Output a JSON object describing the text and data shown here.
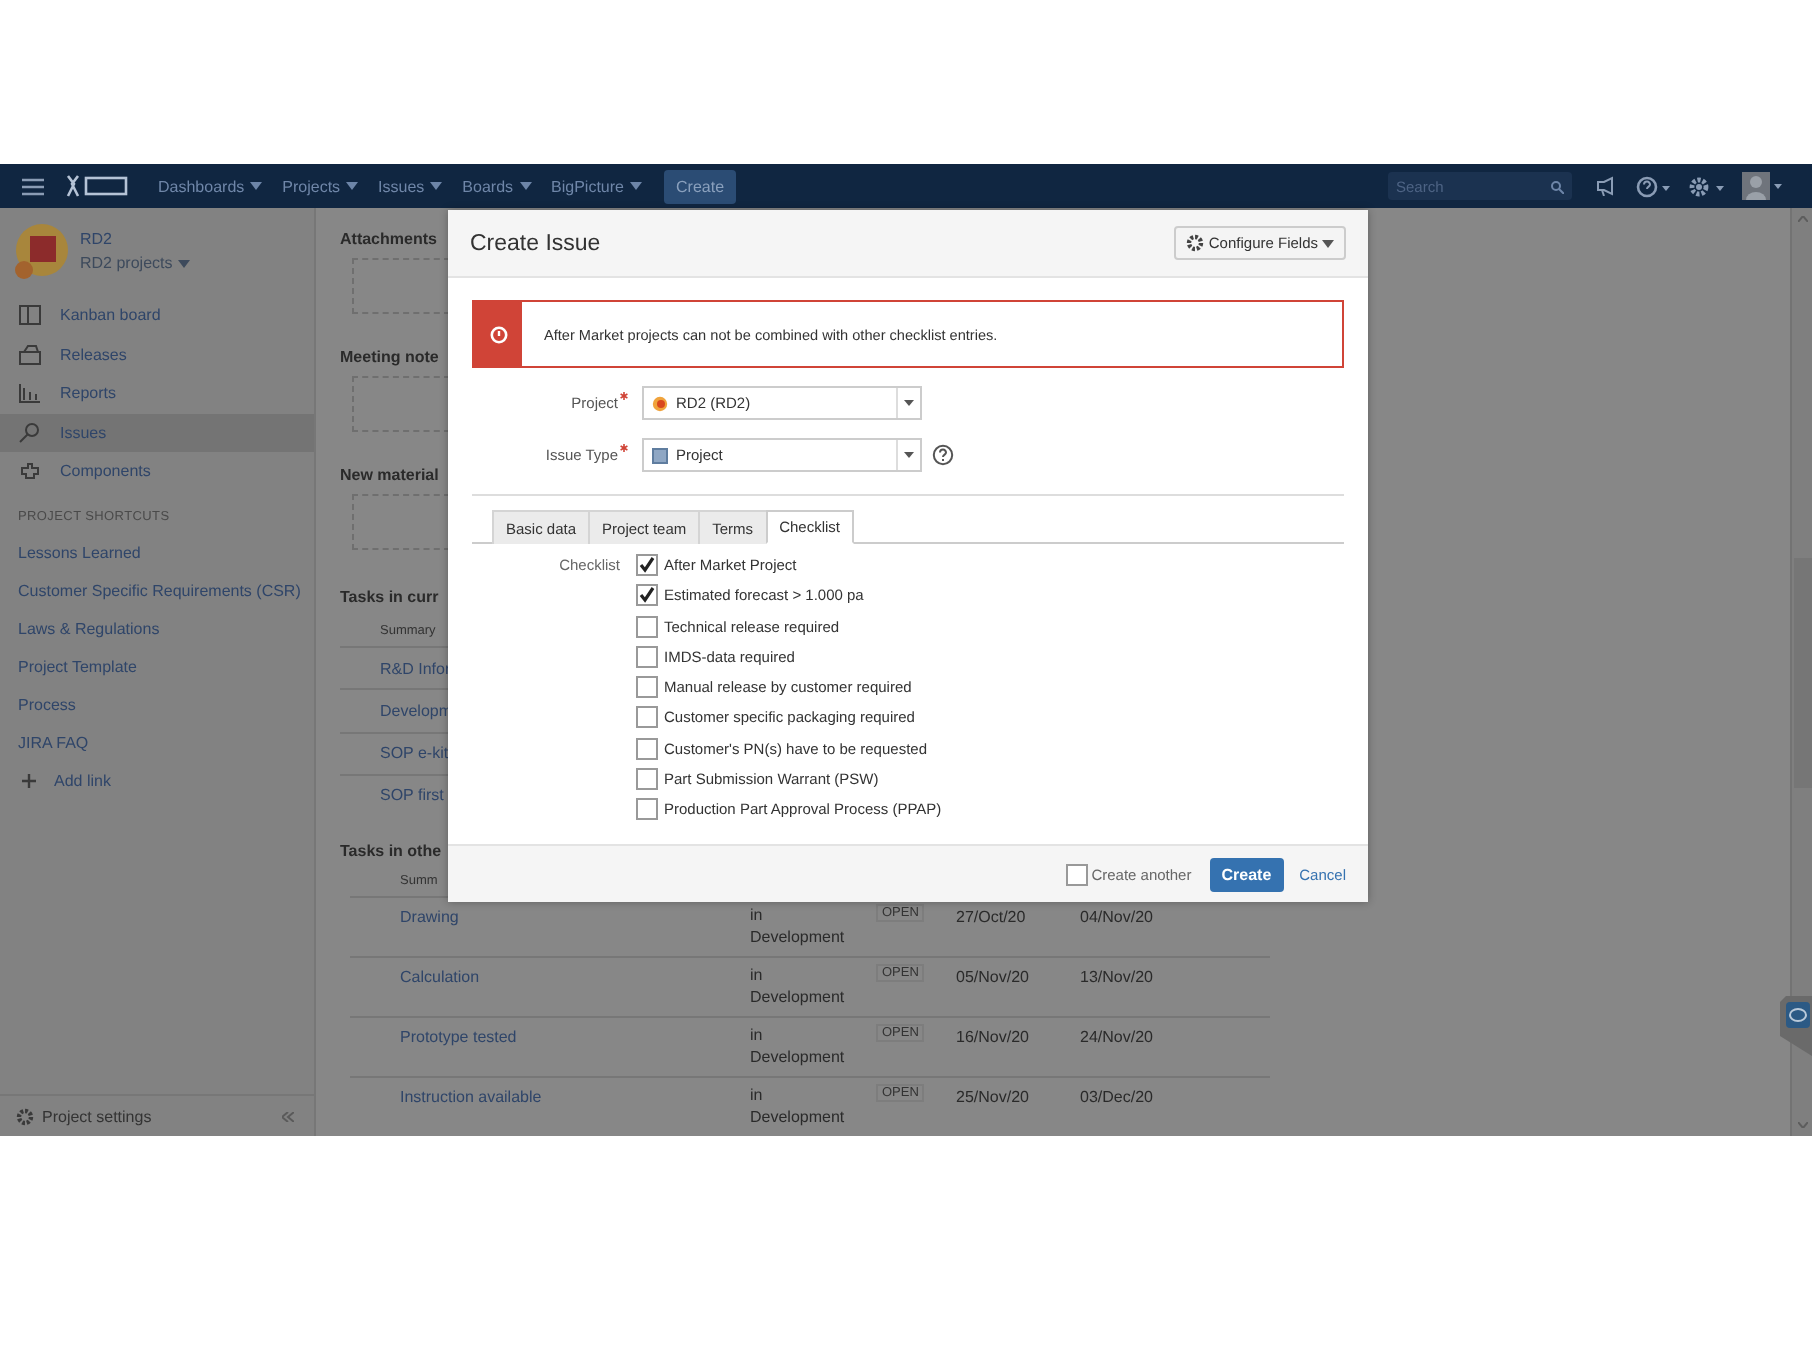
{
  "navbar": {
    "menus": [
      {
        "label": "Dashboards"
      },
      {
        "label": "Projects"
      },
      {
        "label": "Issues"
      },
      {
        "label": "Boards"
      },
      {
        "label": "BigPicture"
      }
    ],
    "create_button": "Create",
    "search": {
      "placeholder": "Search"
    }
  },
  "sidebar": {
    "project": {
      "name": "RD2",
      "subtitle": "RD2 projects"
    },
    "nav": [
      {
        "label": "Kanban board",
        "selected": false
      },
      {
        "label": "Releases",
        "selected": false
      },
      {
        "label": "Reports",
        "selected": false
      },
      {
        "label": "Issues",
        "selected": true
      },
      {
        "label": "Components",
        "selected": false
      }
    ],
    "shortcuts_heading": "PROJECT SHORTCUTS",
    "shortcuts": [
      "Lessons Learned",
      "Customer Specific Requirements (CSR)",
      "Laws & Regulations",
      "Project Template",
      "Process",
      "JIRA FAQ"
    ],
    "add_link": "Add link",
    "settings": "Project settings"
  },
  "background": {
    "sections": [
      "Attachments",
      "Meeting note",
      "New material"
    ],
    "current_tasks": {
      "title": "Tasks in curr",
      "column_1": "Summary",
      "rows": [
        "R&D Infor",
        "Developm",
        "SOP e-kit",
        "SOP first"
      ]
    },
    "other_tasks": {
      "title": "Tasks in othe",
      "column_1": "Summ",
      "rows": [
        {
          "summary": "Drawing",
          "status": "in Development",
          "badge": "OPEN",
          "start": "27/Oct/20",
          "end": "04/Nov/20"
        },
        {
          "summary": "Calculation",
          "status": "in Development",
          "badge": "OPEN",
          "start": "05/Nov/20",
          "end": "13/Nov/20"
        },
        {
          "summary": "Prototype tested",
          "status": "in Development",
          "badge": "OPEN",
          "start": "16/Nov/20",
          "end": "24/Nov/20"
        },
        {
          "summary": "Instruction available",
          "status": "in Development",
          "badge": "OPEN",
          "start": "25/Nov/20",
          "end": "03/Dec/20"
        }
      ]
    }
  },
  "modal": {
    "title": "Create Issue",
    "configure_button": "Configure Fields",
    "error": "After Market projects can not be combined with other checklist entries.",
    "fields": [
      {
        "label": "Project",
        "required": true,
        "value": "RD2 (RD2)"
      },
      {
        "label": "Issue Type",
        "required": true,
        "value": "Project"
      }
    ],
    "tabs": [
      {
        "label": "Basic data",
        "selected": false
      },
      {
        "label": "Project team",
        "selected": false
      },
      {
        "label": "Terms",
        "selected": false
      },
      {
        "label": "Checklist",
        "selected": true
      }
    ],
    "checklist": {
      "label": "Checklist",
      "items": [
        {
          "label": "After Market Project",
          "checked": true
        },
        {
          "label": "Estimated forecast > 1.000 pa",
          "checked": true
        },
        {
          "label": "Technical release required",
          "checked": false
        },
        {
          "label": "IMDS-data required",
          "checked": false
        },
        {
          "label": "Manual release by customer required",
          "checked": false
        },
        {
          "label": "Customer specific packaging required",
          "checked": false
        },
        {
          "label": "Customer's PN(s) have to be requested",
          "checked": false
        },
        {
          "label": "Part Submission Warrant (PSW)",
          "checked": false
        },
        {
          "label": "Production Part Approval Process (PPAP)",
          "checked": false
        }
      ]
    },
    "footer": {
      "create_another": {
        "label": "Create another",
        "checked": false
      },
      "create_button": "Create",
      "cancel": "Cancel"
    }
  }
}
